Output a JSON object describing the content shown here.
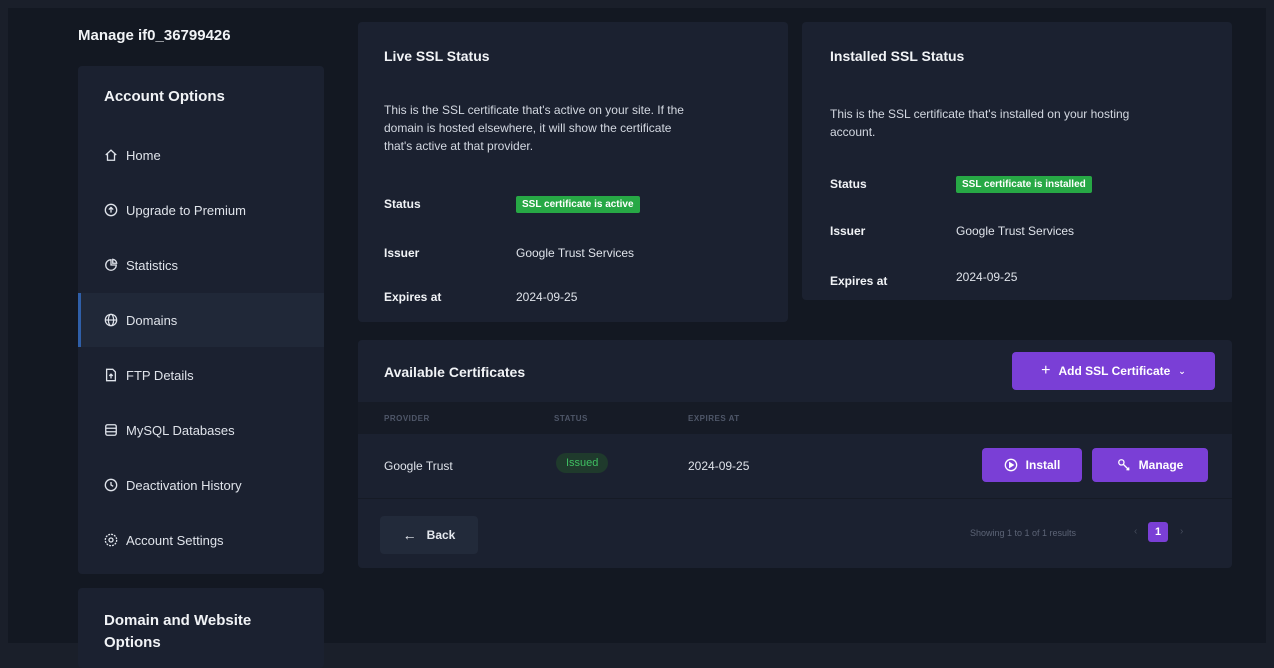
{
  "manage_title": "Manage if0_36799426",
  "sidebar": {
    "heading": "Account Options",
    "items": [
      {
        "label": "Home",
        "icon": "home-icon"
      },
      {
        "label": "Upgrade to Premium",
        "icon": "upgrade-icon"
      },
      {
        "label": "Statistics",
        "icon": "statistics-icon"
      },
      {
        "label": "Domains",
        "icon": "globe-icon",
        "active": true
      },
      {
        "label": "FTP Details",
        "icon": "file-icon"
      },
      {
        "label": "MySQL Databases",
        "icon": "database-icon"
      },
      {
        "label": "Deactivation History",
        "icon": "history-icon"
      },
      {
        "label": "Account Settings",
        "icon": "settings-icon"
      }
    ],
    "section2_heading_line1": "Domain and Website",
    "section2_heading_line2": "Options"
  },
  "live_ssl": {
    "title": "Live SSL Status",
    "desc_line1": "This is the SSL certificate that's active on your site. If the",
    "desc_line2": "domain is hosted elsewhere, it will show the certificate",
    "desc_line3": "that's active at that provider.",
    "status_label": "Status",
    "status_value": "SSL certificate is active",
    "issuer_label": "Issuer",
    "issuer_value": "Google Trust Services",
    "expires_label": "Expires at",
    "expires_value": "2024-09-25"
  },
  "installed_ssl": {
    "title": "Installed SSL Status",
    "desc_line1": "This is the SSL certificate that's installed on your hosting",
    "desc_line2": "account.",
    "status_label": "Status",
    "status_value": "SSL certificate is installed",
    "issuer_label": "Issuer",
    "issuer_value": "Google Trust Services",
    "expires_label": "Expires at",
    "expires_value": "2024-09-25"
  },
  "certificates": {
    "title": "Available Certificates",
    "add_button": "Add SSL Certificate",
    "columns": [
      "PROVIDER",
      "STATUS",
      "EXPIRES AT"
    ],
    "rows": [
      {
        "provider": "Google Trust",
        "status": "Issued",
        "expires": "2024-09-25"
      }
    ],
    "install_button": "Install",
    "manage_button": "Manage",
    "back_button": "Back",
    "pager_text": "Showing 1 to 1 of 1 results",
    "current_page": "1",
    "pager_prev": "‹",
    "pager_next": "›"
  },
  "colors": {
    "accent": "#7a3fd6",
    "success": "#27a845",
    "panel": "#1b2130",
    "background": "#131822"
  }
}
